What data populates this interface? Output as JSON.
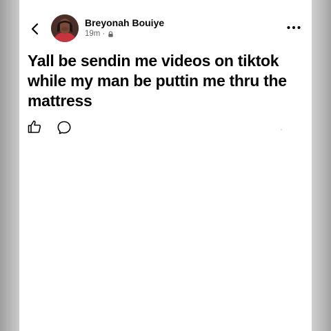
{
  "post": {
    "author_name": "Breyonah Bouiye",
    "time_ago": "19m",
    "separator": "·",
    "text": "Yall be sendin me videos on tiktok while my man be puttin me thru the mattress"
  },
  "icons": {
    "back": "chevron-left-icon",
    "privacy": "lock-icon",
    "more": "more-horizontal-icon",
    "like": "thumbs-up-icon",
    "comment": "comment-icon"
  },
  "colors": {
    "text_primary": "#050505",
    "text_secondary": "#65676b",
    "page_background": "#ffffff",
    "frame_gray": "#b9b9b9"
  }
}
